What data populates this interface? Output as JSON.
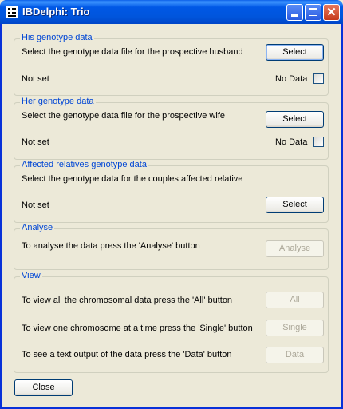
{
  "window": {
    "title": "IBDelphi: Trio"
  },
  "his": {
    "legend": "His genotype data",
    "prompt": "Select the genotype data file for the prospective husband",
    "button": "Select",
    "status": "Not set",
    "check_label": "No Data",
    "checked": false
  },
  "her": {
    "legend": "Her genotype data",
    "prompt": "Select the genotype data file for the prospective wife",
    "button": "Select",
    "status": "Not set",
    "check_label": "No Data",
    "checked": false
  },
  "affected": {
    "legend": "Affected relatives genotype data",
    "prompt": "Select the genotype data for the couples affected relative",
    "button": "Select",
    "status": "Not set"
  },
  "analyse": {
    "legend": "Analyse",
    "prompt": "To analyse the data press the 'Analyse' button",
    "button": "Analyse"
  },
  "view": {
    "legend": "View",
    "all_prompt": "To view all the chromosomal data press the 'All' button",
    "all_button": "All",
    "single_prompt": "To view one chromosome at a time press the 'Single' button",
    "single_button": "Single",
    "data_prompt": "To see a text output of the data press the 'Data' button",
    "data_button": "Data"
  },
  "footer": {
    "close_button": "Close"
  }
}
